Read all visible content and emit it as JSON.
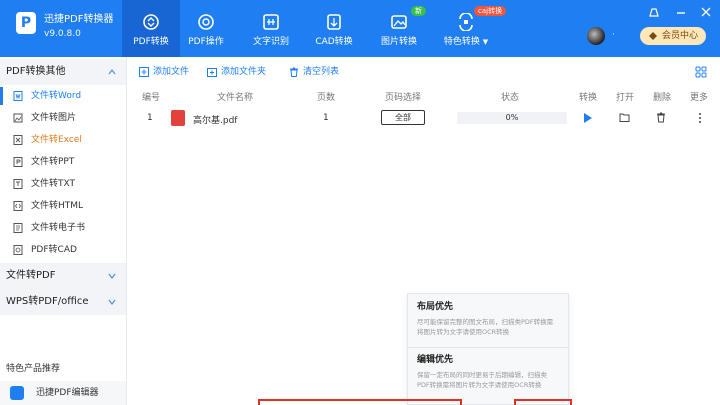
{
  "app": {
    "name": "迅捷PDF转换器",
    "version": "v9.0.8.0"
  },
  "nav": {
    "tabs": [
      {
        "label": "PDF转换",
        "icon": "refresh-icon"
      },
      {
        "label": "PDF操作",
        "icon": "settings-icon"
      },
      {
        "label": "文字识别",
        "icon": "scan-icon"
      },
      {
        "label": "CAD转换",
        "icon": "cad-icon"
      },
      {
        "label": "图片转换",
        "icon": "image-icon"
      },
      {
        "label": "特色转换",
        "icon": "special-icon"
      }
    ],
    "badges": {
      "new": "新",
      "caj": "caj转换"
    },
    "vip_label": "会员中心",
    "user_dot": "·"
  },
  "sidebar": {
    "sections": [
      {
        "label": "PDF转换其他"
      },
      {
        "label": "文件转PDF"
      },
      {
        "label": "WPS转PDF/office"
      }
    ],
    "items": [
      {
        "label": "文件转Word",
        "icon": "word-icon"
      },
      {
        "label": "文件转图片",
        "icon": "picture-icon"
      },
      {
        "label": "文件转Excel",
        "icon": "excel-icon"
      },
      {
        "label": "文件转PPT",
        "icon": "ppt-icon"
      },
      {
        "label": "文件转TXT",
        "icon": "txt-icon"
      },
      {
        "label": "文件转HTML",
        "icon": "html-icon"
      },
      {
        "label": "文件转电子书",
        "icon": "ebook-icon"
      },
      {
        "label": "PDF转CAD",
        "icon": "cad-file-icon"
      }
    ],
    "recommend_title": "特色产品推荐",
    "recommend_item": "迅捷PDF编辑器"
  },
  "toolbar": {
    "add_file": "添加文件",
    "add_folder": "添加文件夹",
    "clear_list": "清空列表"
  },
  "table": {
    "headers": [
      "编号",
      "文件名称",
      "页数",
      "页码选择",
      "状态",
      "转换",
      "打开",
      "删除",
      "更多"
    ],
    "rows": [
      {
        "no": "1",
        "name": "高尔基.pdf",
        "pages": "1",
        "page_select": "全部",
        "status": "0%"
      }
    ]
  },
  "popup": {
    "options": [
      {
        "title": "布局优先",
        "desc": "尽可能保留完整的图文布局，扫描类PDF转换需将图片转为文字请使用OCR转换"
      },
      {
        "title": "编辑优先",
        "desc": "保留一定布局的同时更易于后期编辑，扫描类PDF转换需将图片转为文字请使用OCR转换"
      }
    ]
  },
  "colors": {
    "brand": "#1f7ef2",
    "active_tab": "#1866d3",
    "highlight": "#e07b1a",
    "vip": "#fde6b7",
    "pdf": "#e2423b",
    "box": "#e0302a"
  }
}
